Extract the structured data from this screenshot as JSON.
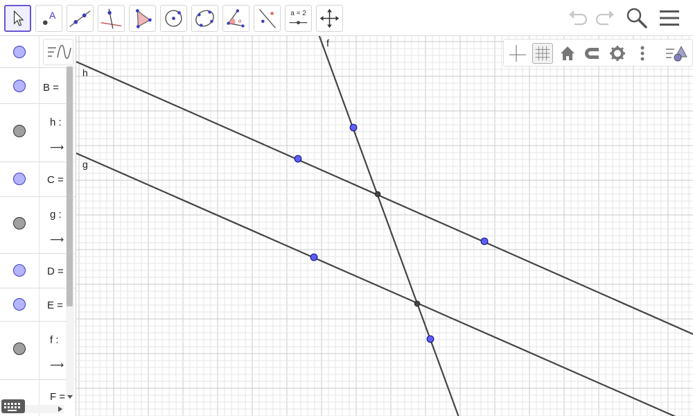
{
  "toolbar": {
    "tools": [
      {
        "name": "move-tool",
        "active": true
      },
      {
        "name": "point-tool",
        "label": "A"
      },
      {
        "name": "line-tool"
      },
      {
        "name": "perpendicular-line-tool"
      },
      {
        "name": "polygon-tool"
      },
      {
        "name": "circle-center-point-tool"
      },
      {
        "name": "conic-five-points-tool"
      },
      {
        "name": "angle-tool"
      },
      {
        "name": "reflect-about-line-tool"
      },
      {
        "name": "slider-tool",
        "label": "a = 2"
      },
      {
        "name": "move-graphics-view-tool"
      }
    ],
    "right": [
      "undo-icon",
      "redo-icon",
      "search-icon",
      "menu-icon"
    ]
  },
  "algebra": {
    "rows": [
      {
        "name": "B",
        "text": "B =",
        "color": "#b4b4ff",
        "type": "point"
      },
      {
        "name": "h",
        "text": "h :",
        "color": "#a0a0a0",
        "type": "line"
      },
      {
        "name": "C",
        "text": "C =",
        "color": "#b4b4ff",
        "type": "point"
      },
      {
        "name": "g",
        "text": "g :",
        "color": "#a0a0a0",
        "type": "line"
      },
      {
        "name": "D",
        "text": "D =",
        "color": "#b4b4ff",
        "type": "point"
      },
      {
        "name": "E",
        "text": "E =",
        "color": "#b4b4ff",
        "type": "point"
      },
      {
        "name": "f",
        "text": "f :",
        "color": "#a0a0a0",
        "type": "line"
      },
      {
        "name": "F",
        "text": "F =",
        "color": "#b4b4ff",
        "type": "point"
      }
    ],
    "arrow_glyph": "⟶"
  },
  "graphics": {
    "lines": [
      {
        "label": "h",
        "color": "#444444"
      },
      {
        "label": "g",
        "color": "#444444"
      },
      {
        "label": "f",
        "color": "#444444"
      }
    ],
    "point_fill": "#5f5fff",
    "intersection_fill": "#444444",
    "grid_minor": "#e6e6e6",
    "grid_major": "#c8c8c8"
  },
  "style_bar": [
    "axes-icon",
    "grid-icon",
    "home-icon",
    "magnet-icon",
    "gear-icon",
    "more-vertical-icon",
    "style-bar-toggle-icon"
  ]
}
